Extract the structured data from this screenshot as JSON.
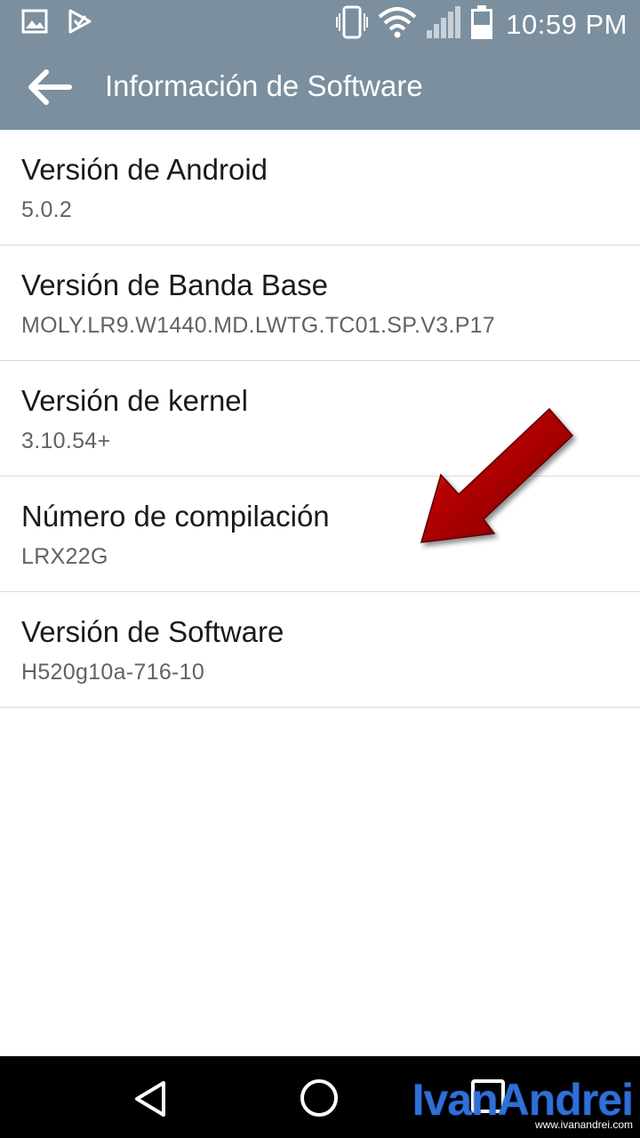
{
  "status_bar": {
    "time": "10:59 PM",
    "icons": [
      "image-notification-icon",
      "play-store-notification-icon",
      "vibrate-icon",
      "wifi-icon",
      "signal-icon",
      "battery-icon"
    ]
  },
  "app_bar": {
    "title": "Información de Software",
    "back_icon": "arrow-back-icon"
  },
  "items": [
    {
      "title": "Versión de Android",
      "value": "5.0.2"
    },
    {
      "title": "Versión de Banda Base",
      "value": "MOLY.LR9.W1440.MD.LWTG.TC01.SP.V3.P17"
    },
    {
      "title": "Versión de kernel",
      "value": "3.10.54+"
    },
    {
      "title": "Número de compilación",
      "value": "LRX22G"
    },
    {
      "title": "Versión de Software",
      "value": "H520g10a-716-10"
    }
  ],
  "annotation": {
    "icon": "red-arrow-icon",
    "color": "#b00000"
  },
  "nav_bar": {
    "icons": [
      "back-triangle-icon",
      "home-circle-icon",
      "recent-apps-icon"
    ]
  },
  "watermark": {
    "logo": "IvanAndrei",
    "url": "www.ivanandrei.com"
  },
  "colors": {
    "app_bar": "#7b8f9e",
    "nav_bar": "#000000",
    "divider": "#d9d9d9"
  }
}
